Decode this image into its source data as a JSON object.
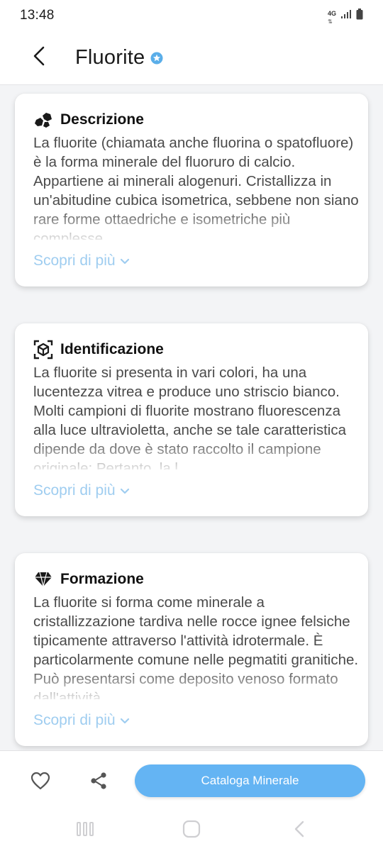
{
  "status_bar": {
    "time": "13:48",
    "network": "4G"
  },
  "header": {
    "title": "Fluorite"
  },
  "sections": [
    {
      "icon": "rocks-icon",
      "title": "Descrizione",
      "text": "La fluorite (chiamata anche fluorina o spatofluore) è la forma minerale del fluoruro di calcio. Appartiene ai minerali alogenuri. Cristallizza in un'abitudine cubica isometrica, sebbene non siano rare forme ottaedriche e isometriche più complesse.",
      "more_label": "Scopri di più"
    },
    {
      "icon": "scan-cube-icon",
      "title": "Identificazione",
      "text": "La fluorite si presenta in vari colori, ha una lucentezza vitrea e produce uno striscio bianco. Molti campioni di fluorite mostrano fluorescenza alla luce ultravioletta, anche se tale caratteristica dipende da dove è stato raccolto il campione originale; Pertanto, la l",
      "more_label": "Scopri di più"
    },
    {
      "icon": "diamond-icon",
      "title": "Formazione",
      "text": "La fluorite si forma come minerale a cristallizzazione tardiva nelle rocce ignee felsiche tipicamente attraverso l'attività idrotermale. È particolarmente comune nelle pegmatiti granitiche. Può presentarsi come deposito venoso formato dall'attività",
      "more_label": "Scopri di più"
    }
  ],
  "actions": {
    "catalog_label": "Cataloga Minerale"
  },
  "colors": {
    "accent": "#64b4f3",
    "link": "#9fcdf0",
    "verified": "#5aaee9"
  }
}
